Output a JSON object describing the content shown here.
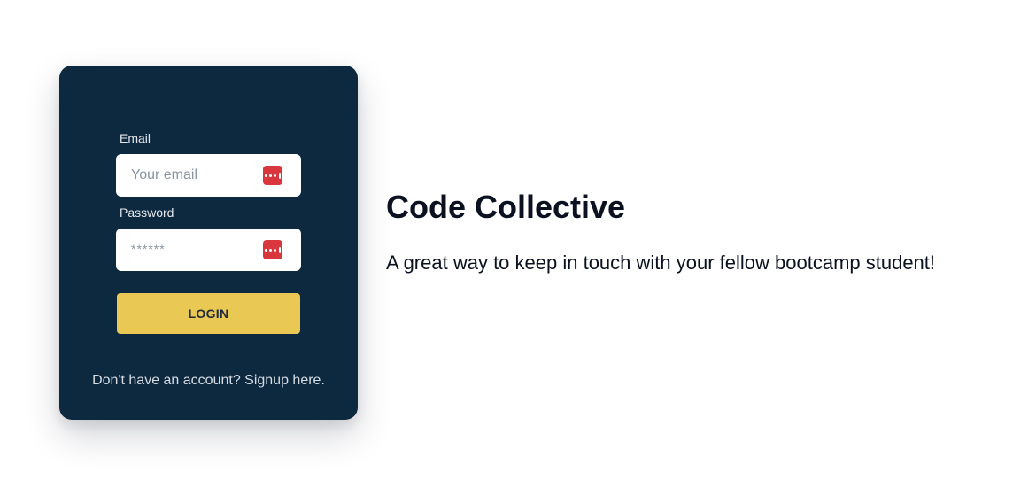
{
  "login_form": {
    "email_label": "Email",
    "email_placeholder": "Your email",
    "password_label": "Password",
    "password_placeholder": "******",
    "login_button": "LOGIN",
    "signup_text": "Don't have an account? Signup here."
  },
  "hero": {
    "title": "Code Collective",
    "tagline": "A great way to keep in touch with your fellow bootcamp student!"
  },
  "icons": {
    "password_manager": "password-manager-icon"
  },
  "colors": {
    "card_background": "#0c2940",
    "login_button": "#e9c853",
    "password_manager_icon": "#d9363e"
  }
}
